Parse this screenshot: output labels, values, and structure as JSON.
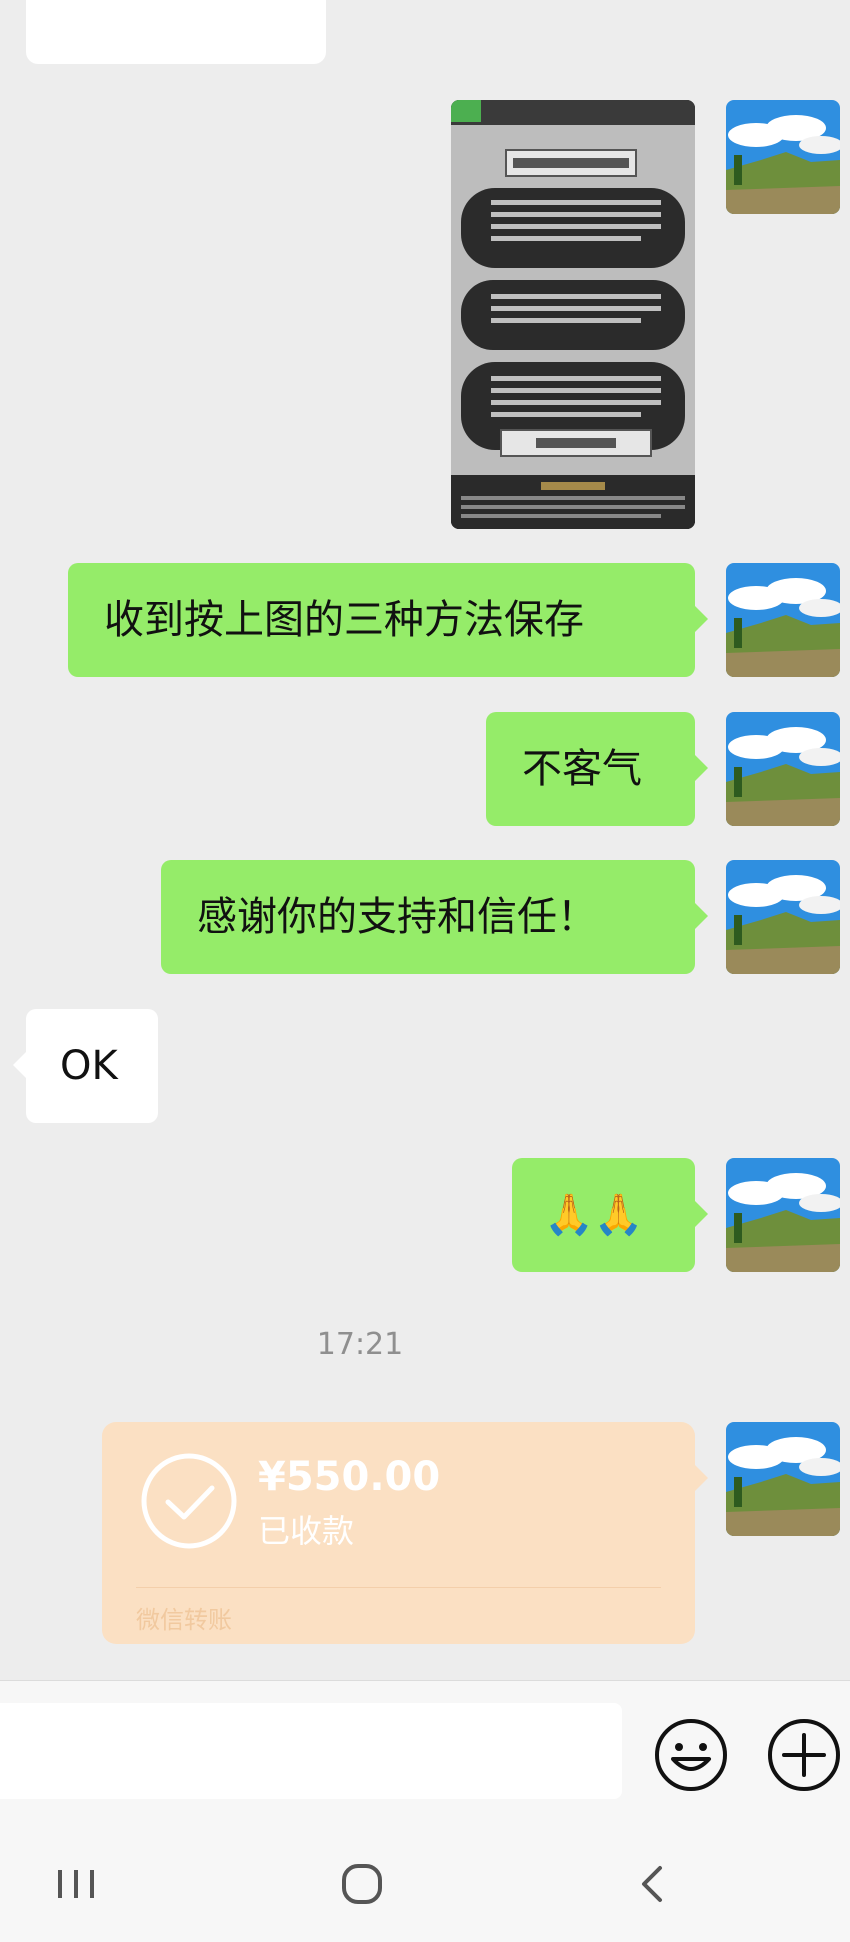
{
  "messages": [
    {
      "type": "image",
      "sender": "me"
    },
    {
      "type": "text",
      "sender": "me",
      "text": "收到按上图的三种方法保存"
    },
    {
      "type": "text",
      "sender": "me",
      "text": "不客气"
    },
    {
      "type": "text",
      "sender": "me",
      "text": "感谢你的支持和信任！"
    },
    {
      "type": "text",
      "sender": "other",
      "text": "OK"
    },
    {
      "type": "text",
      "sender": "me",
      "text": "🙏🙏"
    }
  ],
  "timestamp": "17:21",
  "transfer": {
    "amount": "¥550.00",
    "status": "已收款",
    "footer": "微信转账"
  },
  "colors": {
    "background": "#ededed",
    "my_bubble": "#95ec69",
    "other_bubble": "#ffffff",
    "transfer_card": "#fbe0c3"
  },
  "icons": {
    "emoji": "emoji-icon",
    "more": "plus-circle-icon",
    "nav_recents": "recents-icon",
    "nav_home": "home-icon",
    "nav_back": "back-icon"
  }
}
